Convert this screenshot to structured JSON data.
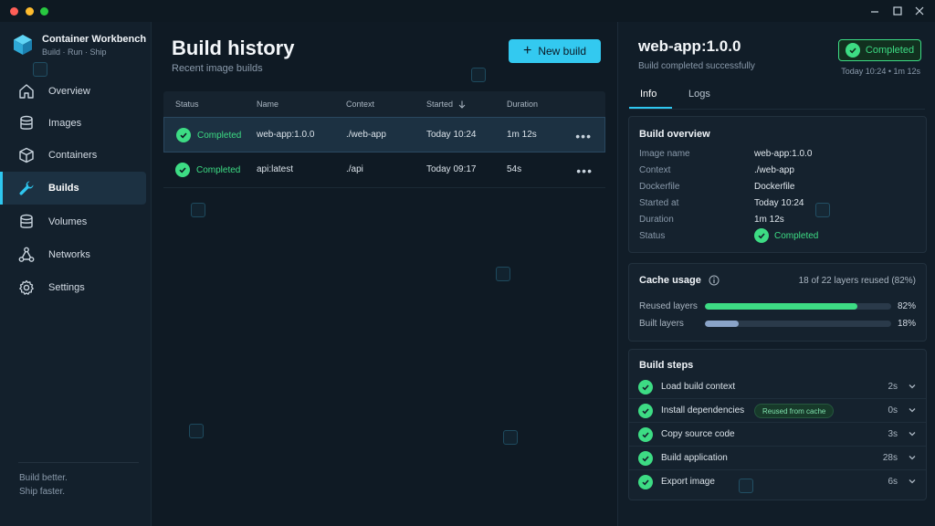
{
  "app": {
    "name": "Container Workbench",
    "tagline": "Build  ·  Run  ·  Ship"
  },
  "sidebar": {
    "items": [
      {
        "label": "Overview",
        "icon": "home-icon"
      },
      {
        "label": "Images",
        "icon": "database-icon"
      },
      {
        "label": "Containers",
        "icon": "box-icon"
      },
      {
        "label": "Builds",
        "icon": "wrench-icon",
        "active": true
      },
      {
        "label": "Volumes",
        "icon": "database-icon"
      },
      {
        "label": "Networks",
        "icon": "network-icon"
      },
      {
        "label": "Settings",
        "icon": "gear-icon"
      }
    ],
    "footer_line1": "Build better.",
    "footer_line2": "Ship faster."
  },
  "main": {
    "title": "Build history",
    "subtitle": "Recent image builds",
    "new_build_label": "New build",
    "columns": {
      "status": "Status",
      "name": "Name",
      "context": "Context",
      "started": "Started",
      "duration": "Duration"
    },
    "rows": [
      {
        "status": "Completed",
        "name": "web-app:1.0.0",
        "context": "./web-app",
        "started": "Today 10:24",
        "duration": "1m 12s",
        "selected": true
      },
      {
        "status": "Completed",
        "name": "api:latest",
        "context": "./api",
        "started": "Today 09:17",
        "duration": "54s"
      }
    ]
  },
  "detail": {
    "title": "web-app:1.0.0",
    "subtitle": "Build completed successfully",
    "badge": "Completed",
    "time": "Today 10:24  •  1m 12s",
    "tabs": {
      "info": "Info",
      "logs": "Logs"
    },
    "overview": {
      "title": "Build overview",
      "fields": [
        {
          "key": "Image name",
          "value": "web-app:1.0.0"
        },
        {
          "key": "Context",
          "value": "./web-app"
        },
        {
          "key": "Dockerfile",
          "value": "Dockerfile"
        },
        {
          "key": "Started at",
          "value": "Today 10:24"
        },
        {
          "key": "Duration",
          "value": "1m 12s"
        },
        {
          "key": "Status",
          "value": "Completed"
        }
      ]
    },
    "cache": {
      "title": "Cache usage",
      "summary": "18 of 22 layers reused (82%)",
      "reused_label": "Reused layers",
      "reused_pct": "82%",
      "reused_value": 82,
      "built_label": "Built layers",
      "built_pct": "18%",
      "built_value": 18
    },
    "steps": {
      "title": "Build steps",
      "items": [
        {
          "label": "Load build context",
          "duration": "2s"
        },
        {
          "label": "Install dependencies",
          "duration": "0s",
          "badge": "Reused from cache"
        },
        {
          "label": "Copy source code",
          "duration": "3s"
        },
        {
          "label": "Build application",
          "duration": "28s"
        },
        {
          "label": "Export image",
          "duration": "6s"
        }
      ]
    }
  },
  "colors": {
    "accent": "#33c9f0",
    "success": "#3ddc84",
    "reused_bar": "#3ddc84",
    "built_bar": "#8aa4c8"
  }
}
